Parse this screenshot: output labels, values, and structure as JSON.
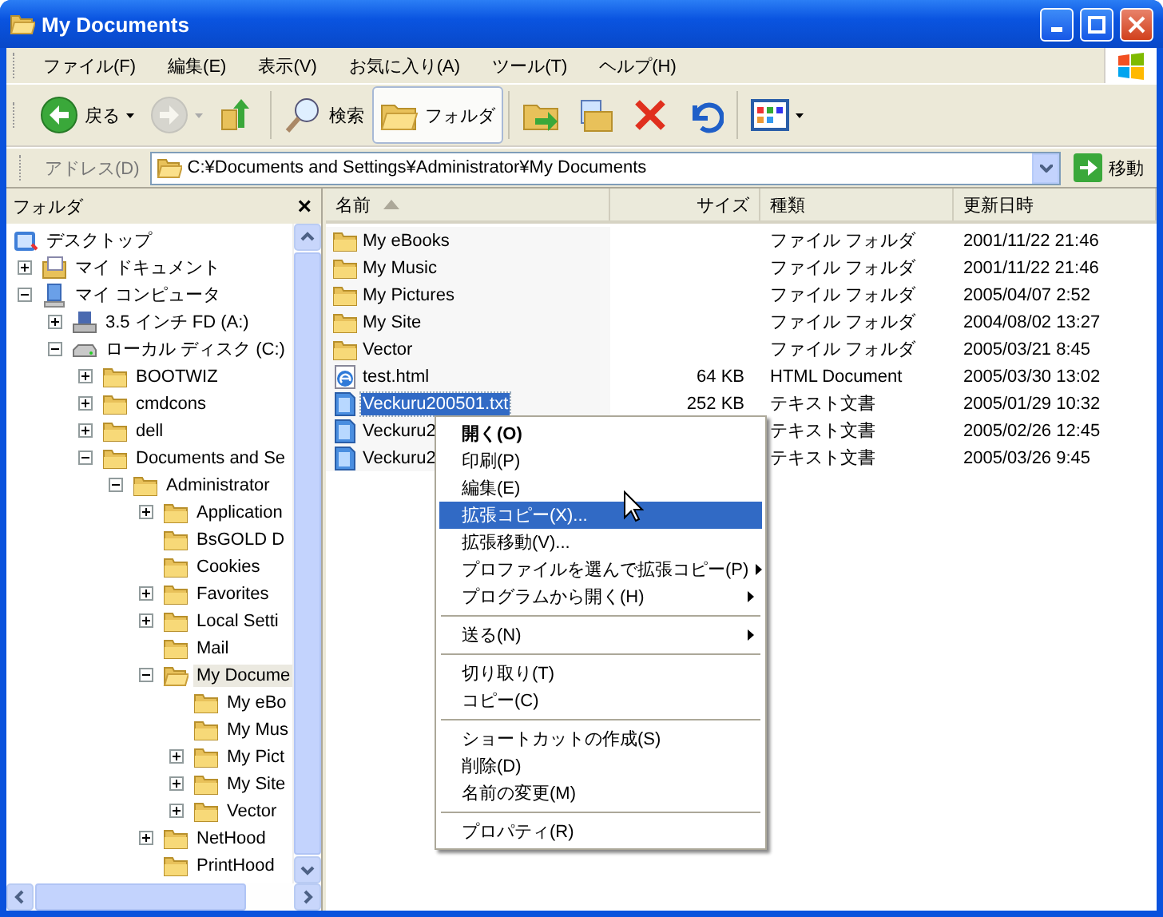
{
  "window": {
    "title": "My Documents"
  },
  "menu_bar": [
    "ファイル(F)",
    "編集(E)",
    "表示(V)",
    "お気に入り(A)",
    "ツール(T)",
    "ヘルプ(H)"
  ],
  "toolbar": [
    {
      "kind": "back",
      "label": "戻る",
      "disabled": false,
      "pressed": false
    },
    {
      "kind": "forward",
      "disabled": true,
      "pressed": false
    },
    {
      "kind": "up",
      "disabled": false,
      "pressed": false
    },
    {
      "kind": "separator"
    },
    {
      "kind": "search",
      "label": "検索",
      "disabled": false,
      "pressed": false
    },
    {
      "kind": "folders",
      "label": "フォルダ",
      "disabled": false,
      "pressed": true
    },
    {
      "kind": "separator"
    },
    {
      "kind": "move",
      "disabled": false,
      "pressed": false
    },
    {
      "kind": "copy",
      "disabled": false,
      "pressed": false
    },
    {
      "kind": "delete",
      "disabled": false,
      "pressed": false
    },
    {
      "kind": "undo",
      "disabled": false,
      "pressed": false
    },
    {
      "kind": "separator"
    },
    {
      "kind": "views",
      "disabled": false,
      "pressed": false
    }
  ],
  "address_bar": {
    "label": "アドレス(D)",
    "value": "C:¥Documents and Settings¥Administrator¥My Documents",
    "go": "移動"
  },
  "folder_pane": {
    "title": "フォルダ",
    "close": "×",
    "tree": [
      {
        "label": "デスクトップ",
        "kind": "desktop",
        "selected": false,
        "children": [
          {
            "label": "マイ ドキュメント",
            "kind": "mydocs",
            "expanded": false,
            "selected": false
          },
          {
            "label": "マイ コンピュータ",
            "kind": "computer",
            "expanded": true,
            "selected": false,
            "children": [
              {
                "label": "3.5 インチ FD (A:)",
                "kind": "floppy",
                "expanded": false,
                "selected": false
              },
              {
                "label": "ローカル ディスク (C:)",
                "kind": "drive",
                "expanded": true,
                "selected": false,
                "children": [
                  {
                    "label": "BOOTWIZ",
                    "kind": "folder",
                    "expanded": false,
                    "selected": false
                  },
                  {
                    "label": "cmdcons",
                    "kind": "folder",
                    "expanded": false,
                    "selected": false
                  },
                  {
                    "label": "dell",
                    "kind": "folder",
                    "expanded": false,
                    "selected": false
                  },
                  {
                    "label": "Documents and Se",
                    "kind": "folder",
                    "expanded": true,
                    "selected": false,
                    "children": [
                      {
                        "label": "Administrator",
                        "kind": "folder",
                        "expanded": true,
                        "selected": false,
                        "children": [
                          {
                            "label": "Application",
                            "kind": "folder",
                            "expanded": false,
                            "selected": false
                          },
                          {
                            "label": "BsGOLD D",
                            "kind": "folder",
                            "selected": false
                          },
                          {
                            "label": "Cookies",
                            "kind": "folder",
                            "selected": false
                          },
                          {
                            "label": "Favorites",
                            "kind": "folder",
                            "expanded": false,
                            "selected": false
                          },
                          {
                            "label": "Local Setti",
                            "kind": "folder",
                            "expanded": false,
                            "selected": false
                          },
                          {
                            "label": "Mail",
                            "kind": "folder",
                            "selected": false
                          },
                          {
                            "label": "My Docume",
                            "kind": "folder-open",
                            "expanded": true,
                            "selected": true,
                            "children": [
                              {
                                "label": "My eBo",
                                "kind": "folder",
                                "selected": false
                              },
                              {
                                "label": "My Mus",
                                "kind": "folder",
                                "selected": false
                              },
                              {
                                "label": "My Pict",
                                "kind": "folder",
                                "expanded": false,
                                "selected": false
                              },
                              {
                                "label": "My Site",
                                "kind": "folder",
                                "expanded": false,
                                "selected": false
                              },
                              {
                                "label": "Vector",
                                "kind": "folder",
                                "expanded": false,
                                "selected": false
                              }
                            ]
                          },
                          {
                            "label": "NetHood",
                            "kind": "folder",
                            "expanded": false,
                            "selected": false
                          },
                          {
                            "label": "PrintHood",
                            "kind": "folder",
                            "selected": false
                          }
                        ]
                      }
                    ]
                  }
                ]
              }
            ]
          }
        ]
      }
    ]
  },
  "file_list": {
    "columns": [
      {
        "label": "名前",
        "sorted": true
      },
      {
        "label": "サイズ",
        "sorted": false
      },
      {
        "label": "種類",
        "sorted": false
      },
      {
        "label": "更新日時",
        "sorted": false
      }
    ],
    "rows": [
      {
        "kind": "folder",
        "name": "My eBooks",
        "type": "ファイル フォルダ",
        "modified": "2001/11/22 21:46",
        "selected": false
      },
      {
        "kind": "folder",
        "name": "My Music",
        "type": "ファイル フォルダ",
        "modified": "2001/11/22 21:46",
        "selected": false
      },
      {
        "kind": "folder",
        "name": "My Pictures",
        "type": "ファイル フォルダ",
        "modified": "2005/04/07 2:52",
        "selected": false
      },
      {
        "kind": "folder",
        "name": "My Site",
        "type": "ファイル フォルダ",
        "modified": "2004/08/02 13:27",
        "selected": false
      },
      {
        "kind": "folder",
        "name": "Vector",
        "type": "ファイル フォルダ",
        "modified": "2005/03/21 8:45",
        "selected": false
      },
      {
        "kind": "html",
        "name": "test.html",
        "size": "64 KB",
        "type": "HTML Document",
        "modified": "2005/03/30 13:02",
        "selected": false
      },
      {
        "kind": "text",
        "name": "Veckuru200501.txt",
        "size": "252 KB",
        "type": "テキスト文書",
        "modified": "2005/01/29 10:32",
        "selected": true
      },
      {
        "kind": "text",
        "name": "Veckuru2",
        "type": "テキスト文書",
        "modified": "2005/02/26 12:45",
        "selected": false
      },
      {
        "kind": "text",
        "name": "Veckuru2",
        "type": "テキスト文書",
        "modified": "2005/03/26 9:45",
        "selected": false
      }
    ]
  },
  "context_menu": [
    {
      "kind": "item",
      "label": "開く(O)",
      "default": true,
      "selected": false,
      "submenu": false
    },
    {
      "kind": "item",
      "label": "印刷(P)",
      "default": false,
      "selected": false,
      "submenu": false
    },
    {
      "kind": "item",
      "label": "編集(E)",
      "default": false,
      "selected": false,
      "submenu": false
    },
    {
      "kind": "item",
      "label": "拡張コピー(X)...",
      "default": false,
      "selected": true,
      "submenu": false
    },
    {
      "kind": "item",
      "label": "拡張移動(V)...",
      "default": false,
      "selected": false,
      "submenu": false
    },
    {
      "kind": "item",
      "label": "プロファイルを選んで拡張コピー(P)",
      "default": false,
      "selected": false,
      "submenu": true
    },
    {
      "kind": "item",
      "label": "プログラムから開く(H)",
      "default": false,
      "selected": false,
      "submenu": true
    },
    {
      "kind": "separator"
    },
    {
      "kind": "item",
      "label": "送る(N)",
      "default": false,
      "selected": false,
      "submenu": true
    },
    {
      "kind": "separator"
    },
    {
      "kind": "item",
      "label": "切り取り(T)",
      "default": false,
      "selected": false,
      "submenu": false
    },
    {
      "kind": "item",
      "label": "コピー(C)",
      "default": false,
      "selected": false,
      "submenu": false
    },
    {
      "kind": "separator"
    },
    {
      "kind": "item",
      "label": "ショートカットの作成(S)",
      "default": false,
      "selected": false,
      "submenu": false
    },
    {
      "kind": "item",
      "label": "削除(D)",
      "default": false,
      "selected": false,
      "submenu": false
    },
    {
      "kind": "item",
      "label": "名前の変更(M)",
      "default": false,
      "selected": false,
      "submenu": false
    },
    {
      "kind": "separator"
    },
    {
      "kind": "item",
      "label": "プロパティ(R)",
      "default": false,
      "selected": false,
      "submenu": false
    }
  ]
}
